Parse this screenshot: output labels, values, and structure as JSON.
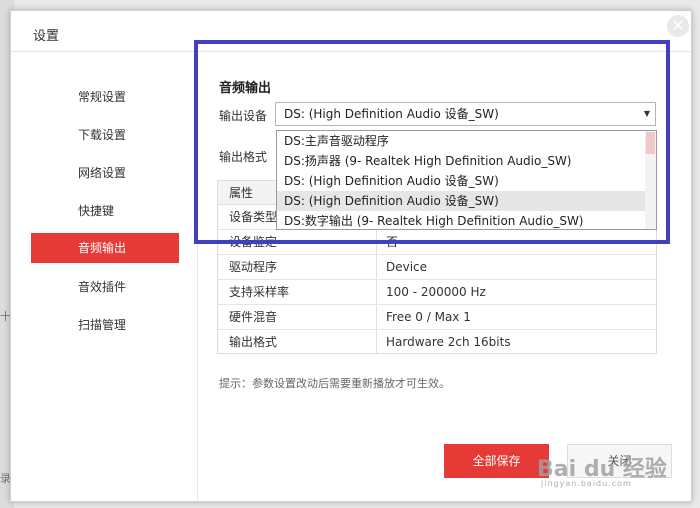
{
  "dialog": {
    "title": "设置",
    "close_glyph": "✕"
  },
  "background": {
    "edge_chars": [
      "十",
      "录"
    ]
  },
  "sidebar": {
    "items": [
      {
        "label": "常规设置",
        "active": false
      },
      {
        "label": "下载设置",
        "active": false
      },
      {
        "label": "网络设置",
        "active": false
      },
      {
        "label": "快捷键",
        "active": false
      },
      {
        "label": "音频输出",
        "active": true
      },
      {
        "label": "音效插件",
        "active": false
      },
      {
        "label": "扫描管理",
        "active": false
      }
    ]
  },
  "audio_output": {
    "section_title": "音频输出",
    "device_label": "输出设备",
    "format_label": "输出格式",
    "selected_device": "DS: (High Definition  Audio 设备_SW)",
    "dropdown_options": [
      "DS:主声音驱动程序",
      "DS:扬声器 (9- Realtek High Definition Audio_SW)",
      "DS: (High Definition  Audio 设备_SW)",
      "DS: (High Definition  Audio 设备_SW)",
      "DS:数字输出 (9- Realtek High Definition Audio_SW)"
    ],
    "highlighted_option_index": 3,
    "arrow_icon": "▼"
  },
  "properties": {
    "header": "属性",
    "rows": [
      {
        "key": "设备类型",
        "value": ""
      },
      {
        "key": "设备鉴定",
        "value": "否"
      },
      {
        "key": "驱动程序",
        "value": "Device"
      },
      {
        "key": "支持采样率",
        "value": "100 - 200000 Hz"
      },
      {
        "key": "硬件混音",
        "value": "Free 0 / Max 1"
      },
      {
        "key": "输出格式",
        "value": "Hardware 2ch 16bits"
      }
    ]
  },
  "tip": "提示：参数设置改动后需要重新播放才可生效。",
  "buttons": {
    "save": "全部保存",
    "cancel": "关闭"
  },
  "watermark": {
    "main": "Bai du 经验",
    "sub": "jingyan.baidu.com"
  },
  "colors": {
    "accent": "#e63a36",
    "highlight_border": "#3f3fbf"
  }
}
